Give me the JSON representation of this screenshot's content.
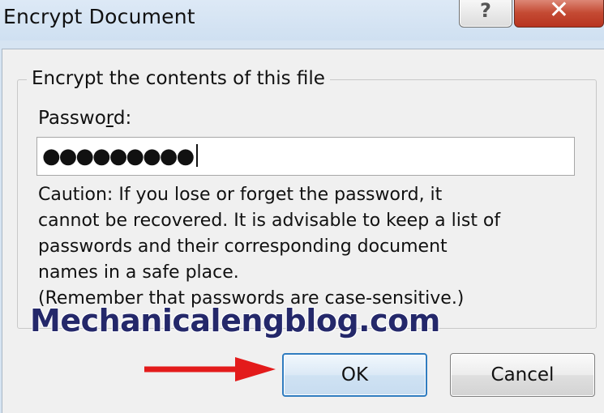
{
  "window": {
    "title": "Encrypt Document",
    "help_icon": "?",
    "close_icon": "✕"
  },
  "group": {
    "title": "Encrypt the contents of this file"
  },
  "password": {
    "label_before": "Passwo",
    "label_access_key": "r",
    "label_after": "d:",
    "value": "●●●●●●●●●"
  },
  "caution": {
    "lines": [
      "Caution: If you lose or forget the password, it",
      "cannot be recovered. It is advisable to keep a list of",
      "passwords and their corresponding document",
      "names in a safe place.",
      "(Remember that passwords are case-sensitive.)"
    ]
  },
  "watermark": {
    "text": "Mechanicalengblog.com"
  },
  "buttons": {
    "ok_label": "OK",
    "cancel_label": "Cancel"
  },
  "colors": {
    "arrow": "#e31b1b",
    "ok_border": "#2f7cc0",
    "close_button": "#c44a33"
  }
}
